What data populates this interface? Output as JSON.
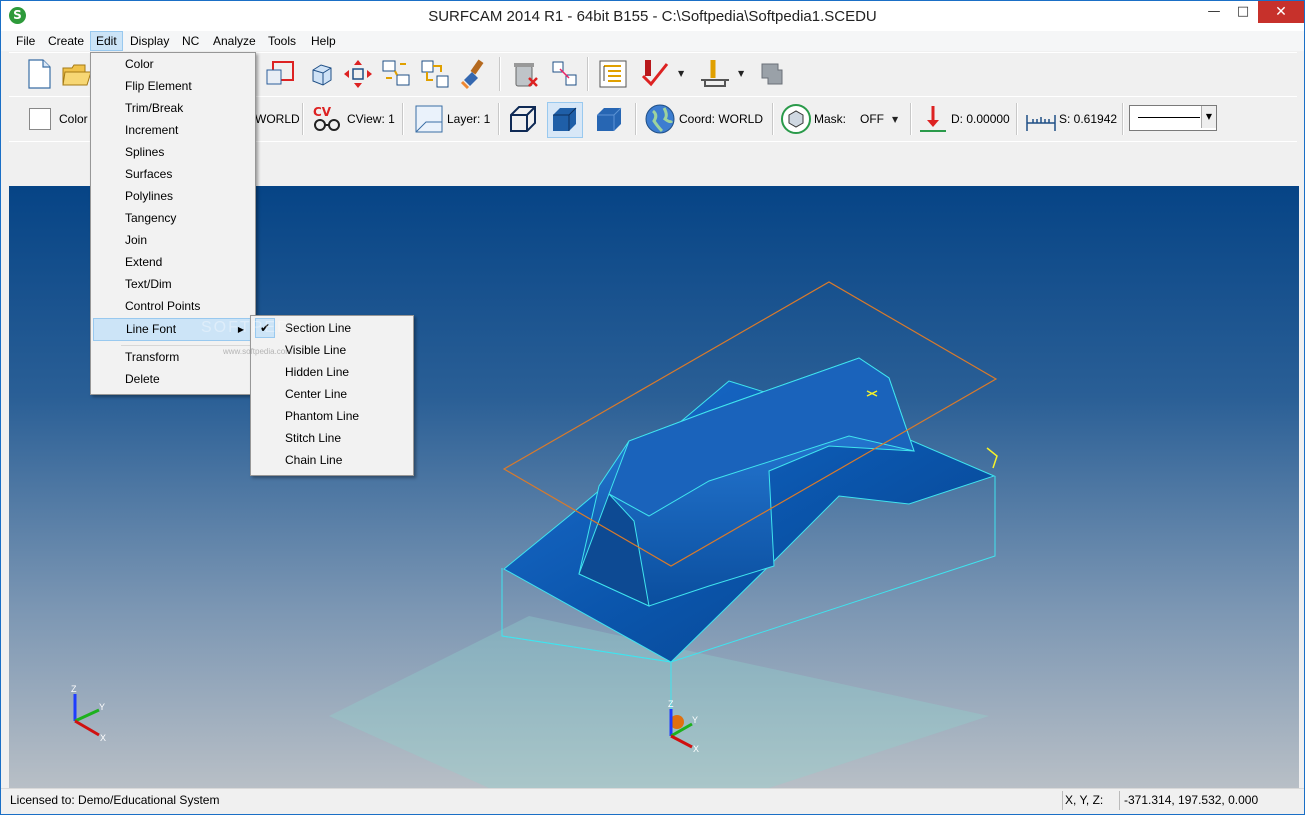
{
  "window": {
    "title": "SURFCAM 2014 R1 - 64bit B155 - C:\\Softpedia\\Softpedia1.SCEDU",
    "app_icon_letter": "S",
    "minimize_glyph": "—",
    "maximize_glyph": "□",
    "close_glyph": "✕"
  },
  "menubar": [
    {
      "label": "File"
    },
    {
      "label": "Create"
    },
    {
      "label": "Edit"
    },
    {
      "label": "Display"
    },
    {
      "label": "NC"
    },
    {
      "label": "Analyze"
    },
    {
      "label": "Tools"
    },
    {
      "label": "Help"
    }
  ],
  "toolbar2": {
    "color_label": "Color",
    "world_label": "WORLD",
    "cview_icon_text": "CV",
    "cview_label": "CView: 1",
    "layer_label": "Layer: 1",
    "coord_label": "Coord: WORLD",
    "mask_label": "Mask:",
    "mask_value": "OFF",
    "depth_label": "D: 0.00000",
    "step_label": "S: 0.61942"
  },
  "edit_menu": [
    {
      "label": "Color"
    },
    {
      "label": "Flip Element"
    },
    {
      "label": "Trim/Break"
    },
    {
      "label": "Increment"
    },
    {
      "label": "Splines"
    },
    {
      "label": "Surfaces"
    },
    {
      "label": "Polylines"
    },
    {
      "label": "Tangency"
    },
    {
      "label": "Join"
    },
    {
      "label": "Extend"
    },
    {
      "label": "Text/Dim"
    },
    {
      "label": "Control Points"
    },
    {
      "label": "Line Font",
      "submenu_arrow": "▶"
    },
    {
      "label": "Transform"
    },
    {
      "label": "Delete"
    }
  ],
  "line_font_submenu": [
    {
      "label": "Section Line",
      "checked": "✔"
    },
    {
      "label": "Visible Line"
    },
    {
      "label": "Hidden Line"
    },
    {
      "label": "Center Line"
    },
    {
      "label": "Phantom Line"
    },
    {
      "label": "Stitch Line"
    },
    {
      "label": "Chain Line"
    }
  ],
  "viewport": {
    "axis_labels": {
      "z": "Z",
      "y": "Y",
      "x": "X"
    },
    "watermark": "SOFTPEDIA",
    "watermark_url": "www.softpedia.com"
  },
  "status": {
    "license": "Licensed to: Demo/Educational System",
    "coord_label": "X, Y, Z:",
    "coord_value": "-371.314, 197.532, 0.000"
  },
  "colors": {
    "part_blue": "#0a5cb8",
    "edge_cyan": "#3fe4ef",
    "plane_orange": "#d97a2b",
    "menu_highlight": "#cce4f7"
  }
}
